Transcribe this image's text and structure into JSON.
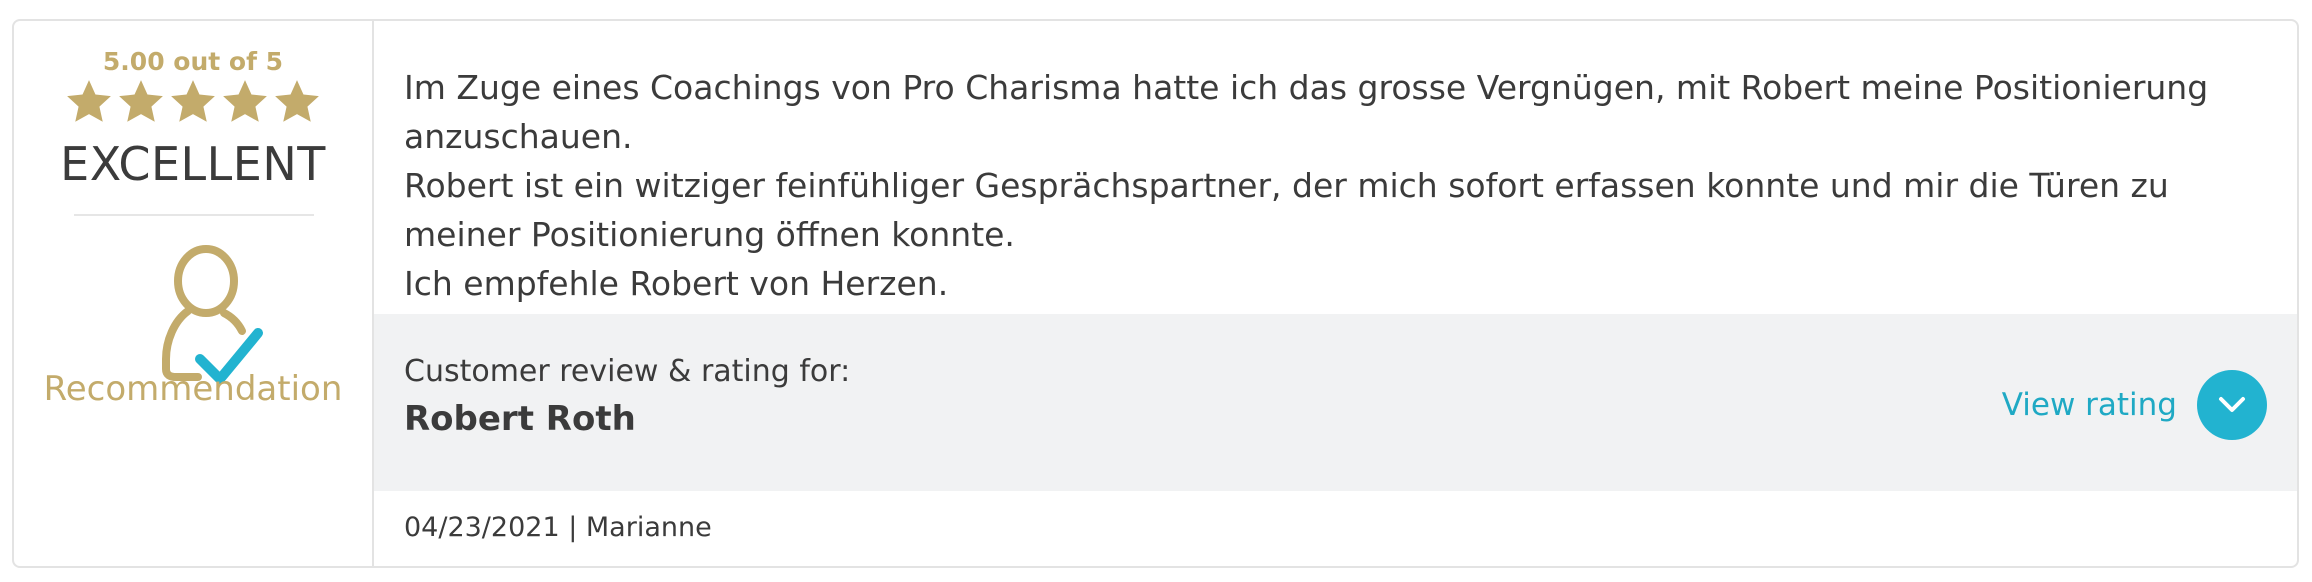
{
  "rating": {
    "score_text": "5.00 out of 5",
    "stars": 5,
    "grade": "EXCELLENT",
    "badge_label": "Recommendation",
    "gold_color": "#c3ab6b",
    "check_color": "#22b3d0"
  },
  "review": {
    "paragraphs": [
      "Im Zuge eines Coachings von Pro Charisma hatte ich das grosse Vergnügen, mit Robert meine Positionierung anzuschauen.",
      "Robert ist ein witziger feinfühliger Gesprächspartner, der mich sofort erfassen konnte und mir die Türen zu meiner Positionierung öffnen konnte.",
      "Ich empfehle Robert von Herzen."
    ]
  },
  "subject": {
    "label": "Customer review & rating for:",
    "name": "Robert Roth"
  },
  "actions": {
    "view_rating": "View rating",
    "accent_color": "#1fa9c4"
  },
  "meta": {
    "line": "04/23/2021 | Marianne"
  }
}
